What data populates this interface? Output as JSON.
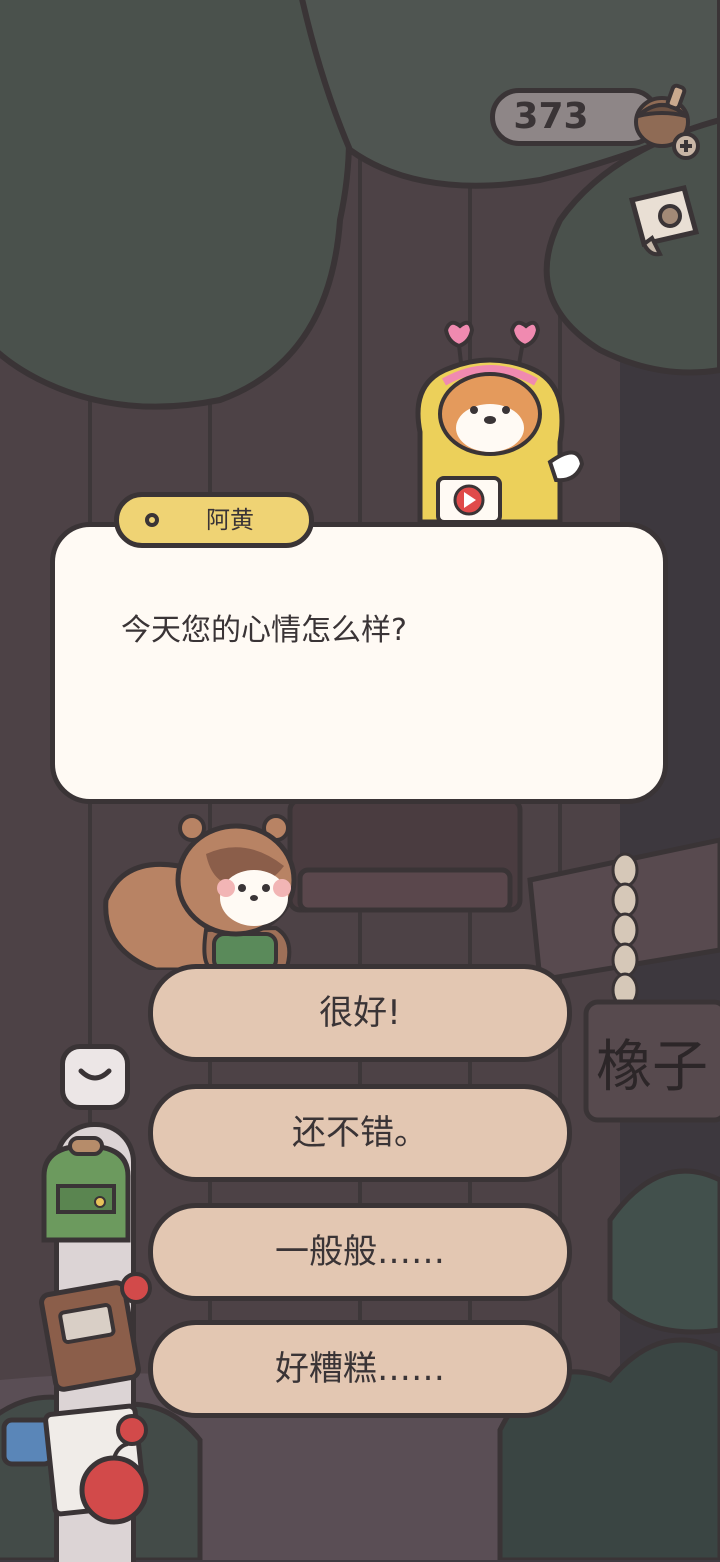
{
  "hud": {
    "acorn_count": "373"
  },
  "dialog": {
    "speaker": "阿黄",
    "text": "今天您的心情怎么样?"
  },
  "choices": [
    {
      "label": "很好!"
    },
    {
      "label": "还不错。"
    },
    {
      "label": "一般般……"
    },
    {
      "label": "好糟糕……"
    }
  ],
  "scene": {
    "sign_text": "橡子"
  },
  "colors": {
    "outline": "#3a3436",
    "dialog_bg": "#fffaf4",
    "name_tag": "#efd374",
    "choice_bg": "#e3c7b2",
    "tree_canopy": "#4a514c"
  }
}
